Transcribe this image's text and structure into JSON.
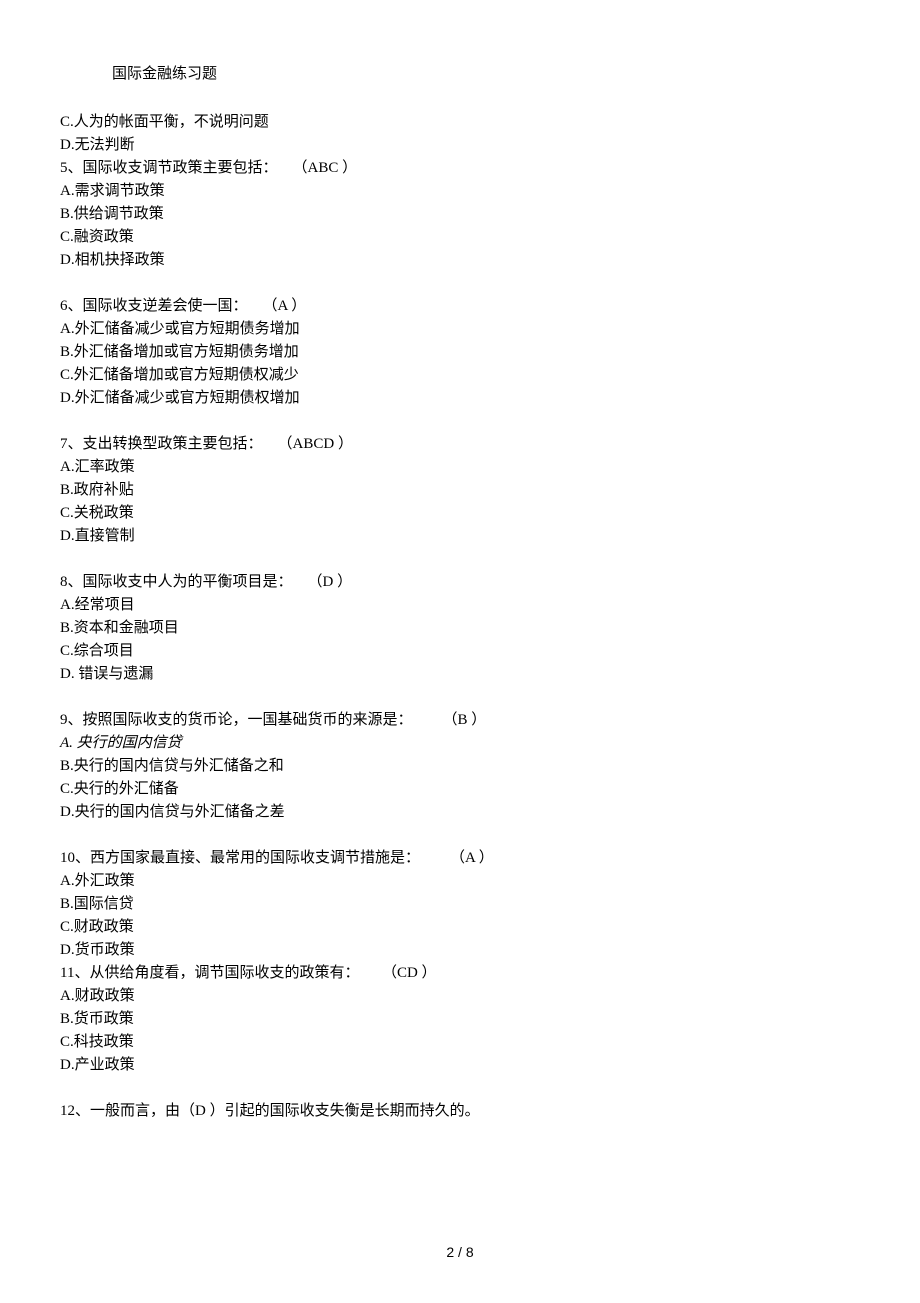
{
  "header": {
    "title": "国际金融练习题"
  },
  "lines": {
    "q4_c": "C.人为的帐面平衡，不说明问题",
    "q4_d": "D.无法判断",
    "q5_text": "5、国际收支调节政策主要包括：",
    "q5_answer": "    （ABC ）",
    "q5_a": "A.需求调节政策",
    "q5_b": "B.供给调节政策",
    "q5_c": "C.融资政策",
    "q5_d": "D.相机抉择政策",
    "q6_text": "6、国际收支逆差会使一国：",
    "q6_answer": "    （A ）",
    "q6_a": "A.外汇储备减少或官方短期债务增加",
    "q6_b": "B.外汇储备增加或官方短期债务增加",
    "q6_c": "C.外汇储备增加或官方短期债权减少",
    "q6_d": "D.外汇储备减少或官方短期债权增加",
    "q7_text": "7、支出转换型政策主要包括：",
    "q7_answer": "    （ABCD ）",
    "q7_a": "A.汇率政策",
    "q7_b": "B.政府补贴",
    "q7_c": "C.关税政策",
    "q7_d": "D.直接管制",
    "q8_text": "8、国际收支中人为的平衡项目是：",
    "q8_answer": "    （D ）",
    "q8_a": "A.经常项目",
    "q8_b": "B.资本和金融项目",
    "q8_c": "C.综合项目",
    "q8_d": "D. 错误与遗漏",
    "q9_text": "9、按照国际收支的货币论，一国基础货币的来源是：",
    "q9_answer": "        （B ）",
    "q9_a": "A. 央行的国内信贷",
    "q9_b": "B.央行的国内信贷与外汇储备之和",
    "q9_c": "C.央行的外汇储备",
    "q9_d": "D.央行的国内信贷与外汇储备之差",
    "q10_text": "10、西方国家最直接、最常用的国际收支调节措施是：",
    "q10_answer": "        （A ）",
    "q10_a": "A.外汇政策",
    "q10_b": "B.国际信贷",
    "q10_c": "C.财政政策",
    "q10_d": "D.货币政策",
    "q11_text": "11、从供给角度看，调节国际收支的政策有：",
    "q11_answer": "      （CD ）",
    "q11_a": "A.财政政策",
    "q11_b": "B.货币政策",
    "q11_c": "C.科技政策",
    "q11_d": "D.产业政策",
    "q12": "12、一般而言，由（D ）引起的国际收支失衡是长期而持久的。"
  },
  "footer": {
    "page": "2 / 8"
  }
}
